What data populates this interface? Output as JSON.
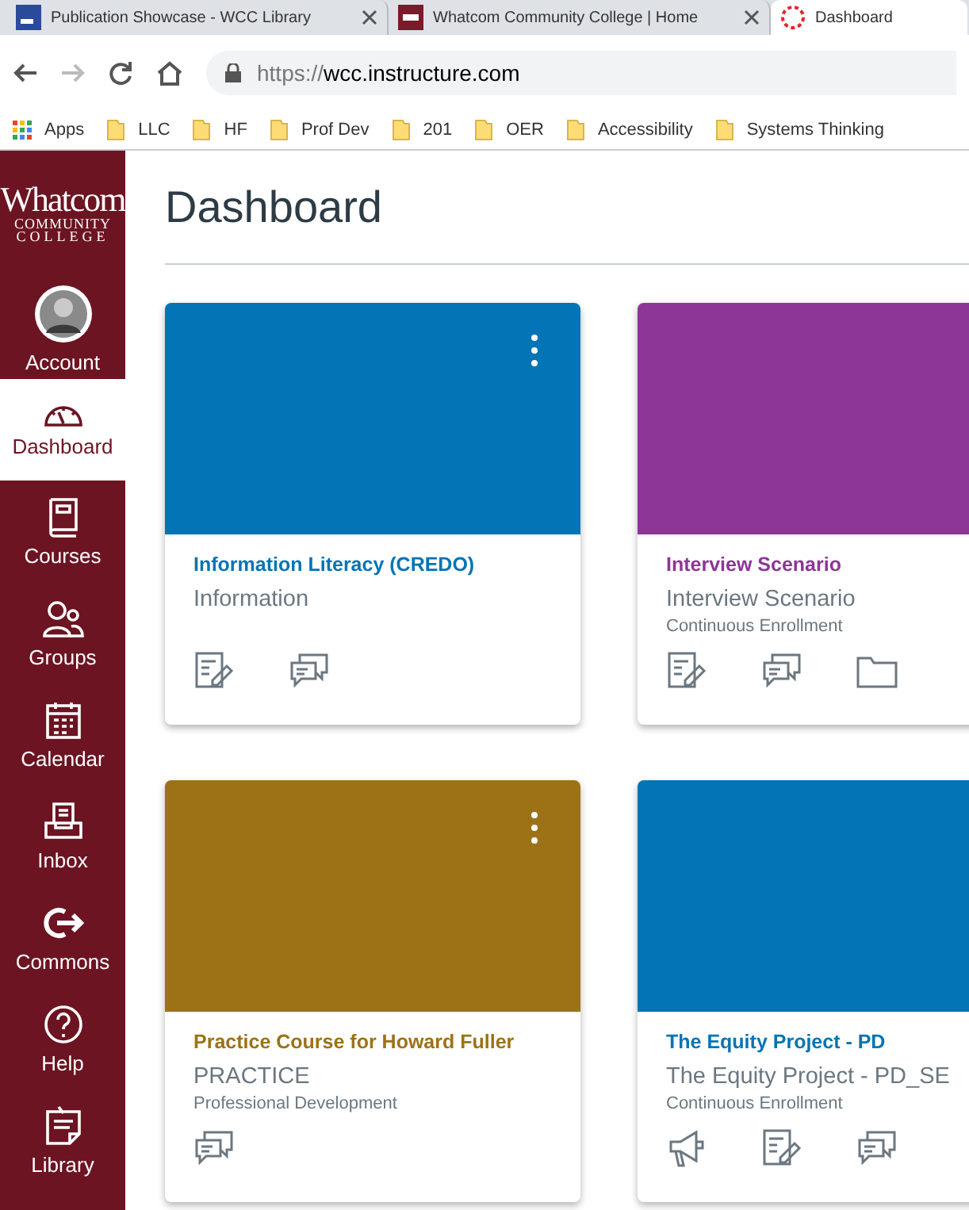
{
  "browser_tabs": [
    {
      "title": "Publication Showcase - WCC Library",
      "kind": "library",
      "selected": false
    },
    {
      "title": "Whatcom Community College | Home",
      "kind": "college",
      "selected": false
    },
    {
      "title": "Dashboard",
      "kind": "canvas",
      "selected": true
    }
  ],
  "address_bar": {
    "url_prefix": "https://",
    "url_host": "wcc.instructure.com"
  },
  "bookmarks": [
    {
      "label": "Apps",
      "kind": "apps"
    },
    {
      "label": "LLC",
      "kind": "folder"
    },
    {
      "label": "HF",
      "kind": "folder"
    },
    {
      "label": "Prof Dev",
      "kind": "folder"
    },
    {
      "label": "201",
      "kind": "folder"
    },
    {
      "label": "OER",
      "kind": "folder"
    },
    {
      "label": "Accessibility",
      "kind": "folder"
    },
    {
      "label": "Systems Thinking",
      "kind": "folder"
    }
  ],
  "sidebar": {
    "logo": {
      "line_1": "Whatcom",
      "line_2": "COMMUNITY",
      "line_3": "COLLEGE"
    },
    "items": [
      {
        "label": "Account",
        "kind": "account",
        "selected": false
      },
      {
        "label": "Dashboard",
        "kind": "dashboard",
        "selected": true
      },
      {
        "label": "Courses",
        "kind": "courses",
        "selected": false
      },
      {
        "label": "Groups",
        "kind": "groups",
        "selected": false
      },
      {
        "label": "Calendar",
        "kind": "calendar",
        "selected": false
      },
      {
        "label": "Inbox",
        "kind": "inbox",
        "selected": false
      },
      {
        "label": "Commons",
        "kind": "commons",
        "selected": false
      },
      {
        "label": "Help",
        "kind": "help",
        "selected": false
      },
      {
        "label": "Library",
        "kind": "library",
        "selected": false
      }
    ]
  },
  "page": {
    "title": "Dashboard"
  },
  "cards": [
    {
      "name": "Information Literacy (CREDO)",
      "code": "Information",
      "color": "#0374b5",
      "links": [
        {
          "kind": "assignments"
        },
        {
          "kind": "discussions"
        }
      ]
    },
    {
      "name": "Interview Scenario",
      "code": "Interview Scenario",
      "term": "Continuous Enrollment",
      "color": "#8e3598",
      "links": [
        {
          "kind": "assignments"
        },
        {
          "kind": "discussions"
        },
        {
          "kind": "files"
        }
      ]
    },
    {
      "name": "Practice Course for Howard Fuller",
      "code": "PRACTICE",
      "term": "Professional Development",
      "color": "#9d7217",
      "links": [
        {
          "kind": "discussions"
        }
      ]
    },
    {
      "name": "The Equity Project - PD",
      "code": "The Equity Project - PD_SE",
      "term": "Continuous Enrollment",
      "color": "#0374b5",
      "links": [
        {
          "kind": "announcements"
        },
        {
          "kind": "assignments"
        },
        {
          "kind": "discussions"
        }
      ]
    }
  ]
}
